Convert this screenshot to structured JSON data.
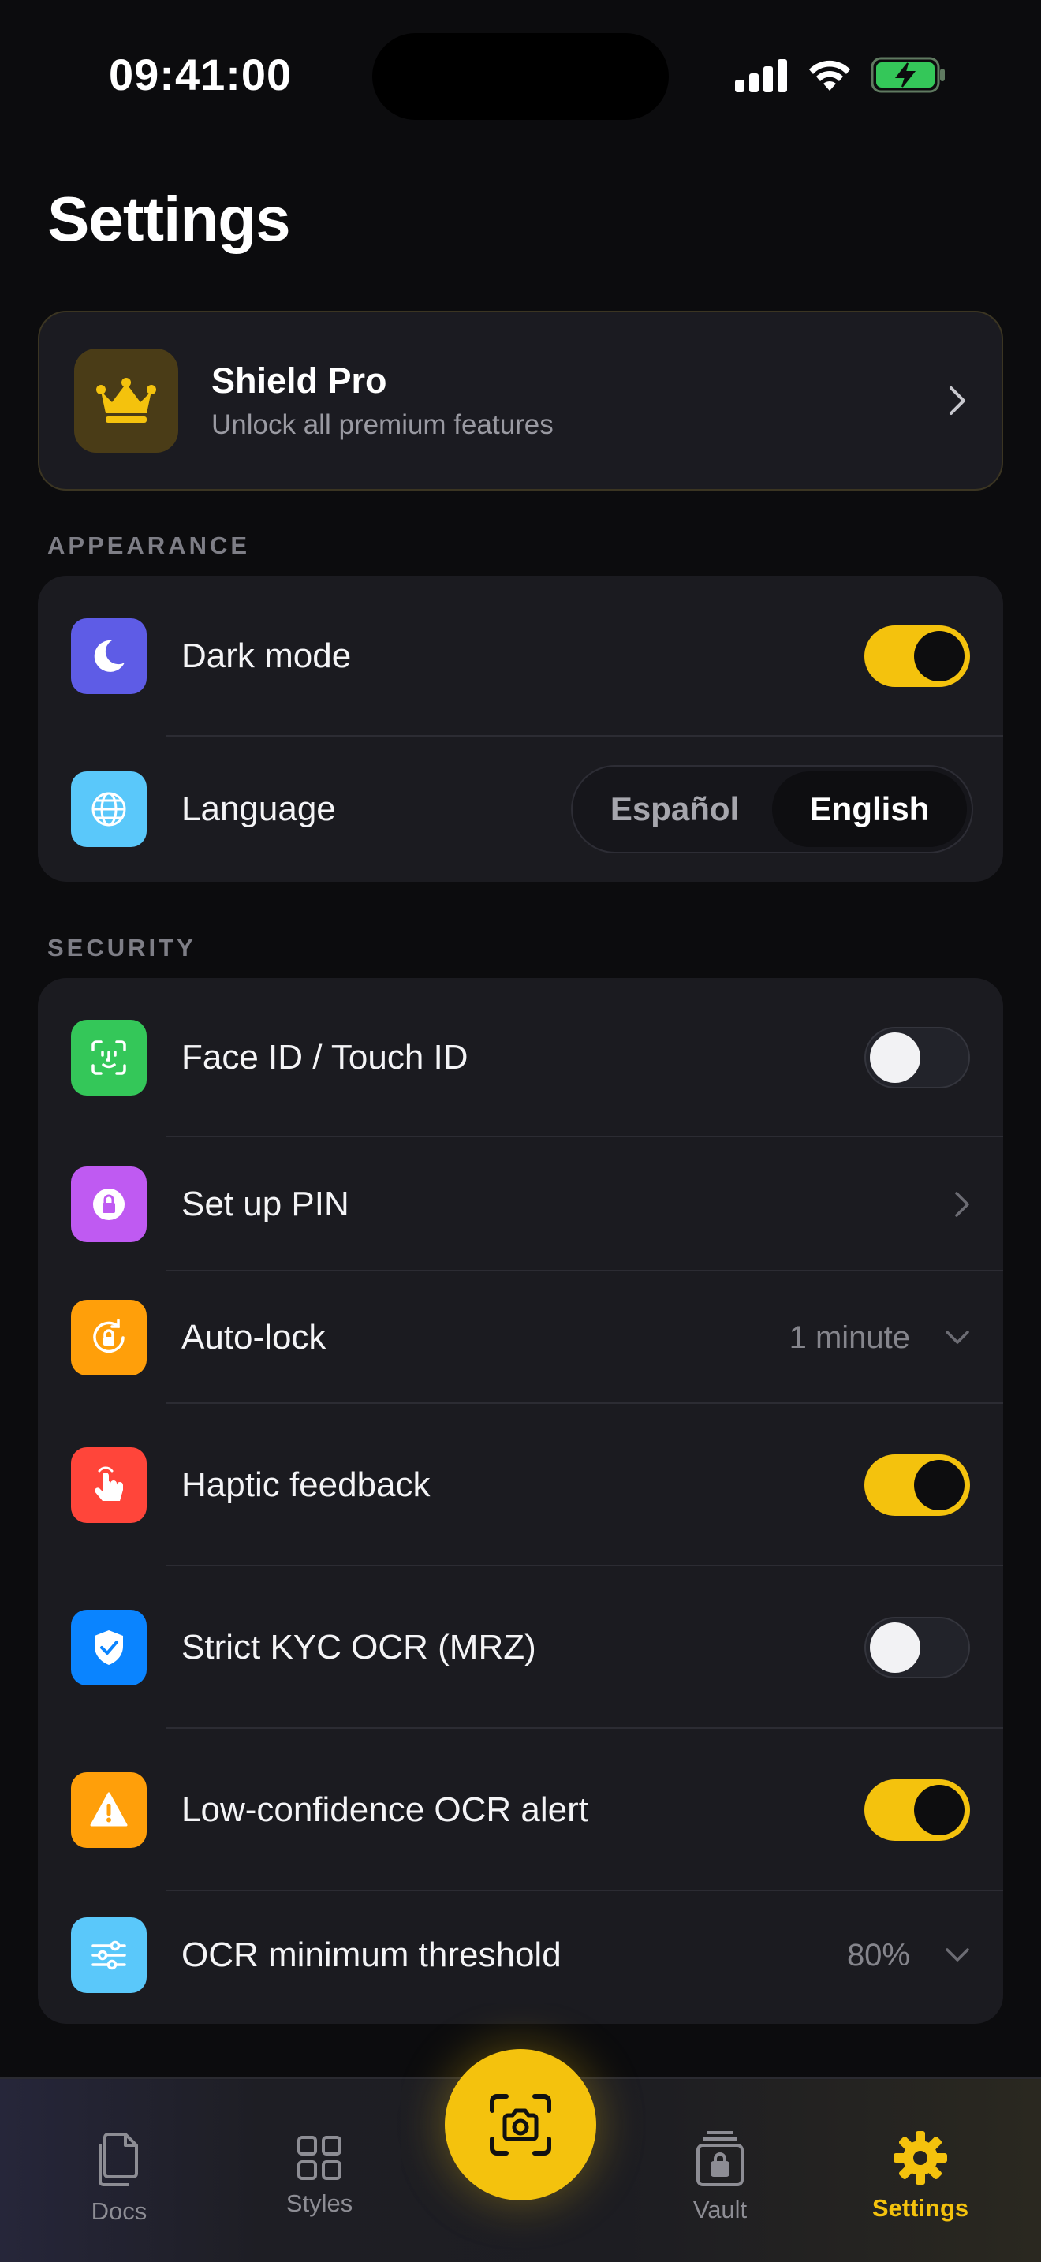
{
  "status_bar": {
    "time": "09:41:00"
  },
  "header": {
    "title": "Settings"
  },
  "pro_card": {
    "title": "Shield Pro",
    "subtitle": "Unlock all premium features"
  },
  "appearance": {
    "section_label": "APPEARANCE",
    "dark_mode": {
      "label": "Dark mode",
      "enabled": true
    },
    "language": {
      "label": "Language",
      "options": [
        "Español",
        "English"
      ],
      "selected": "English"
    }
  },
  "security": {
    "section_label": "SECURITY",
    "face_id": {
      "label": "Face ID / Touch ID",
      "enabled": false
    },
    "pin": {
      "label": "Set up PIN"
    },
    "auto_lock": {
      "label": "Auto-lock",
      "value": "1 minute"
    },
    "haptic": {
      "label": "Haptic feedback",
      "enabled": true
    },
    "strict_kyc": {
      "label": "Strict KYC OCR (MRZ)",
      "enabled": false
    },
    "low_conf": {
      "label": "Low-confidence OCR alert",
      "enabled": true
    },
    "ocr_threshold": {
      "label": "OCR minimum threshold",
      "value": "80%"
    }
  },
  "bottom_nav": {
    "items": [
      {
        "label": "Docs"
      },
      {
        "label": "Styles"
      },
      {
        "label": "Vault"
      },
      {
        "label": "Settings"
      }
    ],
    "active": "Settings"
  },
  "colors": {
    "accent": "#f4c20d",
    "dark_mode_icon": "#5e5ce6",
    "language_icon": "#5ac8fa",
    "face_id_icon": "#34c759",
    "pin_icon": "#bf5af2",
    "auto_lock_icon": "#ff9f0a",
    "haptic_icon": "#ff453a",
    "strict_kyc_icon": "#0a84ff",
    "low_conf_icon": "#ff9f0a",
    "threshold_icon": "#5ac8fa"
  }
}
